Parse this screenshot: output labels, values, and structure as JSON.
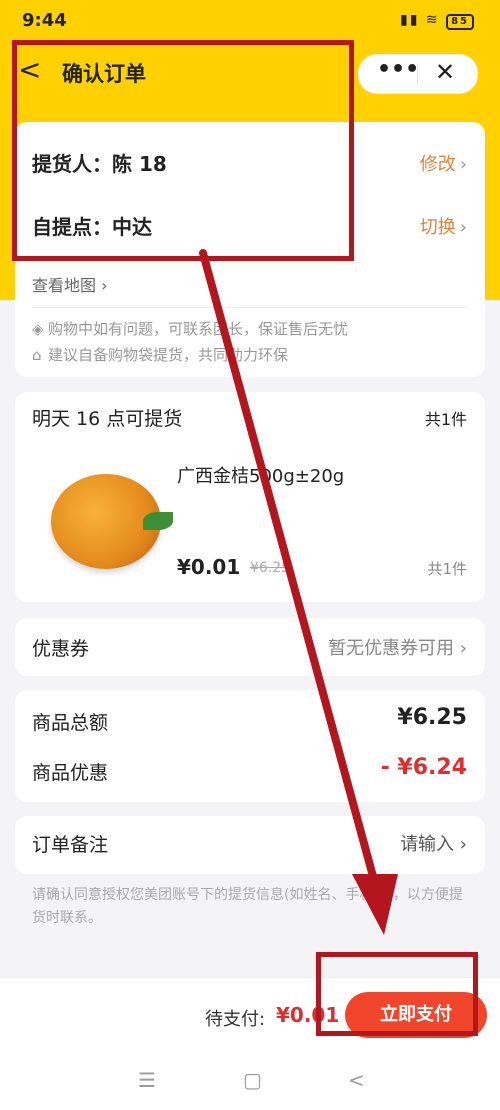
{
  "status": {
    "time": "9:44",
    "battery": "85"
  },
  "navbar": {
    "back": "<",
    "title": "确认订单",
    "more": "•••",
    "close": "✕"
  },
  "pickup": {
    "person_label": "提货人：",
    "person_value": "陈   18",
    "edit": "修改",
    "point_label": "自提点：",
    "point_value": "中达",
    "switch": "切换",
    "map_link": "查看地图",
    "tip1": "购物中如有问题，可联系团长，保证售后无忧",
    "tip2": "建议自备购物袋提货，共同助力环保"
  },
  "goods": {
    "pickup_time": "明天 16 点可提货",
    "count": "共1件",
    "name": "广西金桔500g±20g",
    "price": "¥0.01",
    "original_price": "¥6.25",
    "qty": "共1件"
  },
  "coupon": {
    "label": "优惠券",
    "value": "暂无优惠券可用"
  },
  "summary": {
    "total_label": "商品总额",
    "total_value": "¥6.25",
    "discount_label": "商品优惠",
    "discount_value": "- ¥6.24"
  },
  "remark": {
    "label": "订单备注",
    "placeholder": "请输入"
  },
  "notice": "请确认同意授权您美团账号下的提货信息(如姓名、手机号)，以方便提货时联系。",
  "footer": {
    "pay_label": "待支付:",
    "pay_amount": "¥0.01",
    "pay_button": "立即支付"
  },
  "sysnav": {
    "menu": "☰",
    "home": "▢",
    "back": "<"
  },
  "icons": {
    "shield": "shield-icon",
    "bag": "bag-icon",
    "chevron": "chevron-right-icon"
  },
  "colors": {
    "header_yellow": "#ffd100",
    "accent_red": "#e02e2e",
    "pay_button": "#f1462c",
    "annotation": "#b3161c"
  }
}
